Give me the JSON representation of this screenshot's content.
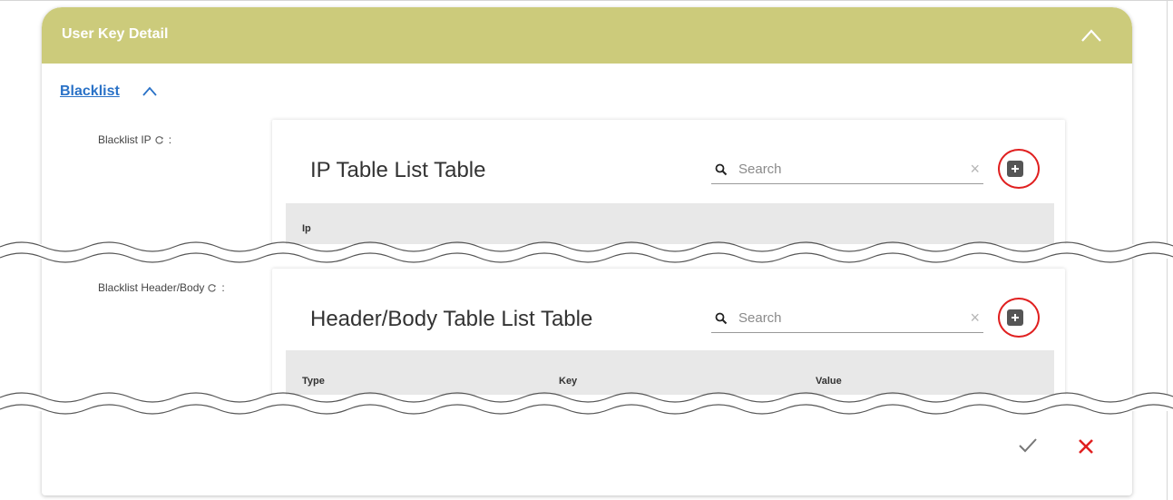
{
  "panel": {
    "title": "User Key Detail",
    "collapse_icon": "chevron-up-icon",
    "accent": "#cccb7b"
  },
  "section": {
    "label": "Blacklist",
    "chevron_icon": "chevron-up-icon",
    "link_color": "#2a72c7"
  },
  "fields": [
    {
      "label": "Blacklist IP",
      "refresh_icon": "refresh-icon",
      "colon": ":",
      "table": {
        "title": "IP Table List Table",
        "search_placeholder": "Search",
        "clear_label": "×",
        "add_icon": "plus-icon",
        "columns": [
          "Ip"
        ]
      }
    },
    {
      "label": "Blacklist Header/Body",
      "refresh_icon": "refresh-icon",
      "colon": ":",
      "table": {
        "title": "Header/Body Table List Table",
        "search_placeholder": "Search",
        "clear_label": "×",
        "add_icon": "plus-icon",
        "columns": [
          "Type",
          "Key",
          "Value"
        ]
      }
    }
  ],
  "actions": {
    "confirm_icon": "check-icon",
    "cancel_icon": "close-icon",
    "cancel_color": "#e02020",
    "highlight_color": "#e02020"
  }
}
